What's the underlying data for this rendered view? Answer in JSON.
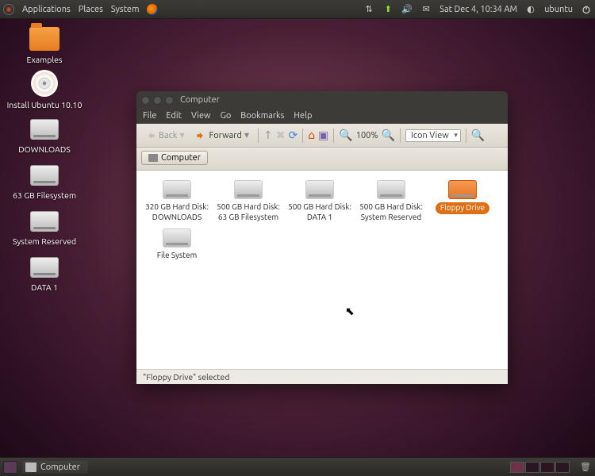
{
  "panel": {
    "menus": [
      "Applications",
      "Places",
      "System"
    ],
    "clock": "Sat Dec 4, 10:34 AM",
    "user": "ubuntu"
  },
  "desktop_icons": [
    {
      "label": "Examples",
      "type": "folder"
    },
    {
      "label": "Install Ubuntu 10.10",
      "type": "cd"
    },
    {
      "label": "DOWNLOADS",
      "type": "hdd"
    },
    {
      "label": "63 GB Filesystem",
      "type": "hdd"
    },
    {
      "label": "System Reserved",
      "type": "hdd"
    },
    {
      "label": "DATA 1",
      "type": "hdd"
    }
  ],
  "window": {
    "title": "Computer",
    "menubar": [
      "File",
      "Edit",
      "View",
      "Go",
      "Bookmarks",
      "Help"
    ],
    "toolbar": {
      "back": "Back",
      "forward": "Forward",
      "zoom_pct": "100%",
      "view_mode": "Icon View"
    },
    "path_label": "Computer",
    "items": [
      {
        "line1": "320 GB Hard Disk:",
        "line2": "DOWNLOADS",
        "selected": false
      },
      {
        "line1": "500 GB Hard Disk:",
        "line2": "63 GB Filesystem",
        "selected": false
      },
      {
        "line1": "500 GB Hard Disk:",
        "line2": "DATA 1",
        "selected": false
      },
      {
        "line1": "500 GB Hard Disk:",
        "line2": "System Reserved",
        "selected": false
      },
      {
        "line1": "Floppy Drive",
        "line2": "",
        "selected": true
      },
      {
        "line1": "File System",
        "line2": "",
        "selected": false
      }
    ],
    "status": "\"Floppy Drive\" selected"
  },
  "taskbar": {
    "task": "Computer"
  }
}
